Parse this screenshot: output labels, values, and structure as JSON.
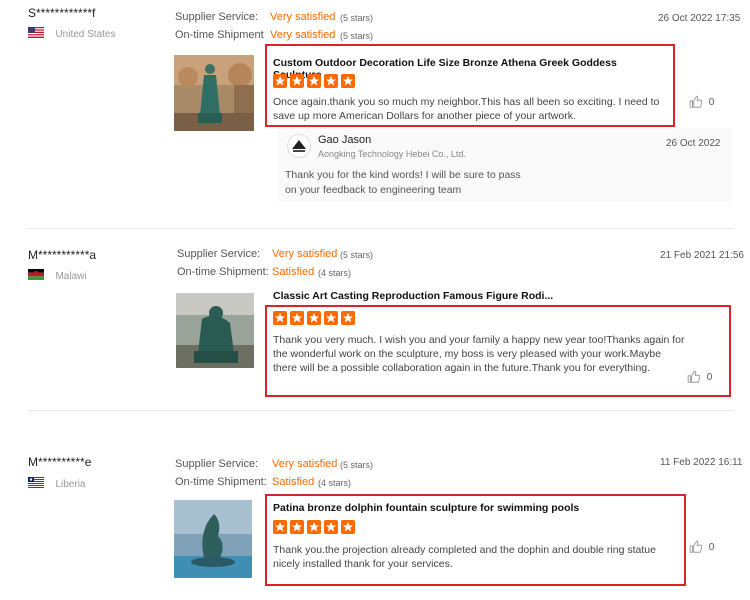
{
  "reviews": [
    {
      "user": "S************f",
      "country": "United States",
      "supplier_label": "Supplier Service:",
      "supplier_rating": "Very satisfied",
      "supplier_stars": "(5 stars)",
      "shipment_label": "On-time Shipment",
      "shipment_rating": "Very satisfied",
      "shipment_stars": "(5 stars)",
      "date": "26 Oct 2022 17:35",
      "product": "Custom Outdoor Decoration Life Size Bronze Athena Greek Goddess Sculpture",
      "text": "Once again.thank you so much my neighbor.This has all been so exciting. I need to save up more American Dollars for another piece of your artwork.",
      "likes": "0",
      "reply": {
        "name": "Gao Jason",
        "company": "Aongking Technology Hebei Co., Ltd.",
        "date": "26 Oct 2022",
        "text": "Thank you for the kind words! I will be sure to pass on your feedback to engineering team"
      }
    },
    {
      "user": "M***********a",
      "country": "Malawi",
      "supplier_label": "Supplier Service:",
      "supplier_rating": "Very satisfied",
      "supplier_stars": "(5 stars)",
      "shipment_label": "On-time Shipment:",
      "shipment_rating": "Satisfied",
      "shipment_stars": "(4 stars)",
      "date": "21 Feb 2021 21:56",
      "product": "Classic Art Casting Reproduction Famous Figure Rodi...",
      "text": "Thank you very much. I wish you and your family a happy new year too!Thanks again for the wonderful work on the sculpture, my boss is very pleased with your work.Maybe there will be a possible collaboration again in the future.Thank you for everything.",
      "likes": "0"
    },
    {
      "user": "M**********e",
      "country": "Liberia",
      "supplier_label": "Supplier Service:",
      "supplier_rating": "Very satisfied",
      "supplier_stars": "(5 stars)",
      "shipment_label": "On-time Shipment:",
      "shipment_rating": "Satisfied",
      "shipment_stars": "(4 stars)",
      "date": "11 Feb 2022 16:11",
      "product": "Patina bronze dolphin fountain sculpture for swimming pools",
      "text": "Thank you.the projection already completed and the dophin and double ring statue nicely installed thank for your services.",
      "likes": "0"
    }
  ],
  "colors": {
    "accent": "#ff6a00",
    "highlight_border": "#d9242a"
  }
}
